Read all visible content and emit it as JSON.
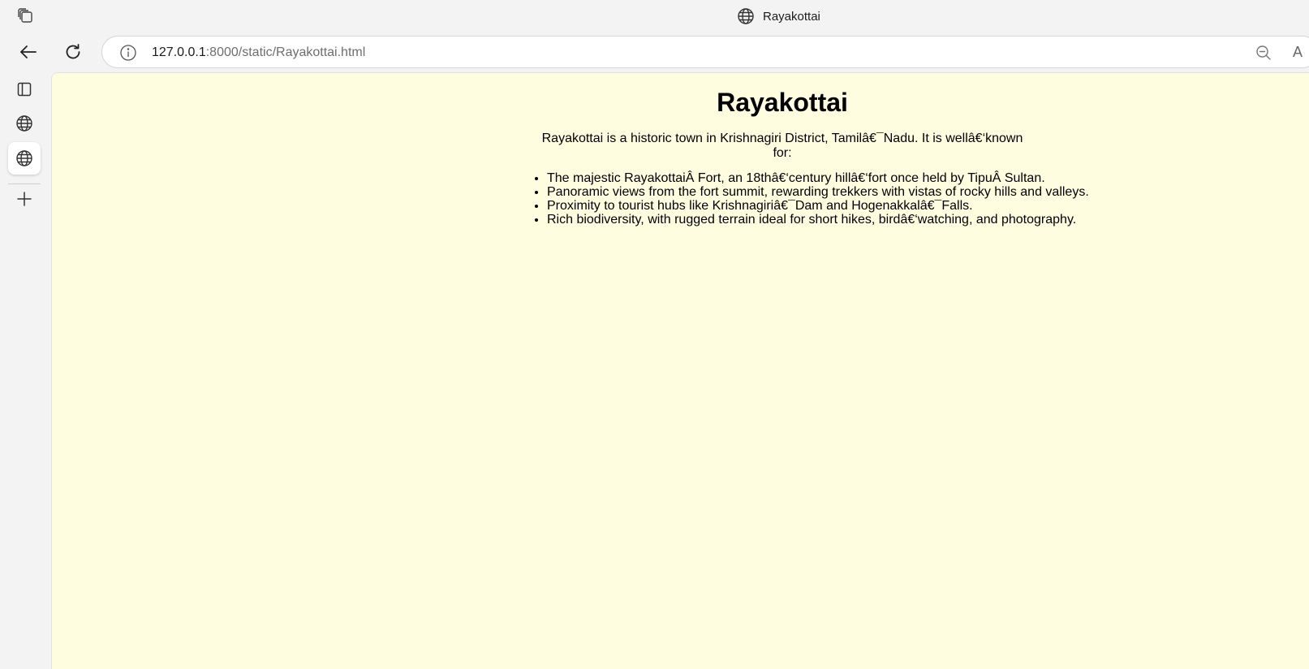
{
  "browser": {
    "window_title": "Rayakottai",
    "url_host": "127.0.0.1",
    "url_rest": ":8000/static/Rayakottai.html",
    "read_aloud_glyph": "A",
    "icons": {
      "tab_actions": "tab-actions-icon",
      "back": "back-arrow-icon",
      "reload": "reload-icon",
      "site_info": "info-icon",
      "zoom": "zoom-out-icon",
      "read_aloud": "read-aloud-icon",
      "sidebar_tab_manager": "tab-manager-icon",
      "sidebar_tab_globe": "globe-icon",
      "sidebar_new_tab": "plus-icon"
    }
  },
  "page": {
    "background": "#fffddf",
    "title": "Rayakottai",
    "intro": "Rayakottai is a historic town in Krishnagiri District, Tamilâ€¯Nadu. It is wellâ€‘known for:",
    "facts": [
      "The majestic RayakottaiÂ Fort, an 18thâ€‘century hillâ€‘fort once held by TipuÂ Sultan.",
      "Panoramic views from the fort summit, rewarding trekkers with vistas of rocky hills and valleys.",
      "Proximity to tourist hubs like Krishnagiriâ€¯Dam and Hogenakkalâ€¯Falls.",
      "Rich biodiversity, with rugged terrain ideal for short hikes, birdâ€‘watching, and photography."
    ]
  }
}
